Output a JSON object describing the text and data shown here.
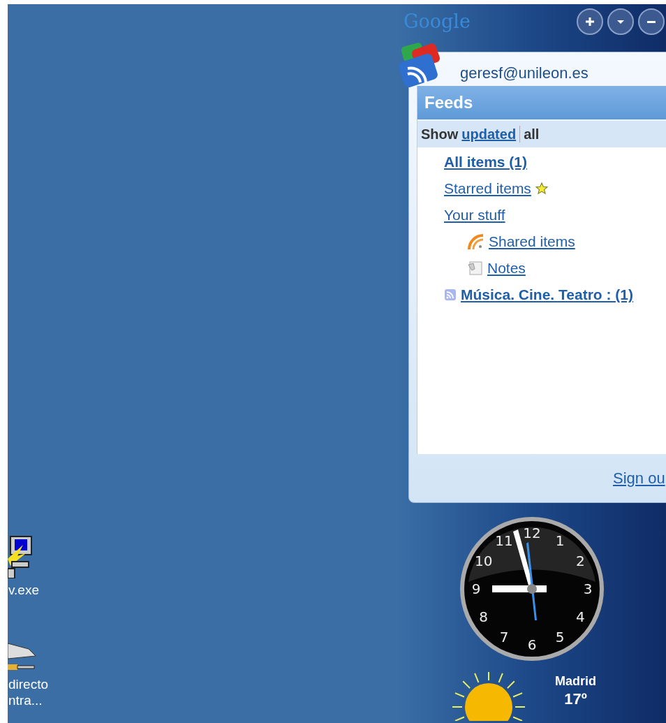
{
  "desktop_icons": [
    {
      "kind": "computer",
      "label": "v.exe"
    },
    {
      "kind": "drive",
      "label": "directo",
      "label_2": "ntra..."
    }
  ],
  "sidebar": {
    "logo": "Google",
    "buttons": [
      {
        "kind": "add"
      },
      {
        "kind": "menu"
      },
      {
        "kind": "minimize"
      }
    ]
  },
  "reader": {
    "account": "geresf@unileon.es",
    "panel_title": "Feeds",
    "show_label": "Show",
    "filters": [
      {
        "label": "updated",
        "selected": false
      },
      {
        "label": "all",
        "selected": true
      }
    ],
    "items": [
      {
        "label": "All items (1)",
        "bold": true,
        "kind": "plain"
      },
      {
        "label": "Starred items",
        "bold": false,
        "kind": "starred"
      },
      {
        "label": "Your stuff",
        "bold": false,
        "kind": "plain",
        "children": [
          {
            "label": "Shared items",
            "bold": false,
            "kind": "shared"
          },
          {
            "label": "Notes",
            "bold": false,
            "kind": "note"
          }
        ]
      },
      {
        "label": "Música. Cine. Teatro : (1)",
        "bold": true,
        "kind": "feed"
      }
    ],
    "sign_out": "Sign ou"
  },
  "clock": {
    "numerals": [
      "12",
      "1",
      "2",
      "3",
      "4",
      "5",
      "6",
      "7",
      "8",
      "9",
      "10",
      "11"
    ]
  },
  "weather": {
    "city": "Madrid",
    "temperature": "17º"
  }
}
